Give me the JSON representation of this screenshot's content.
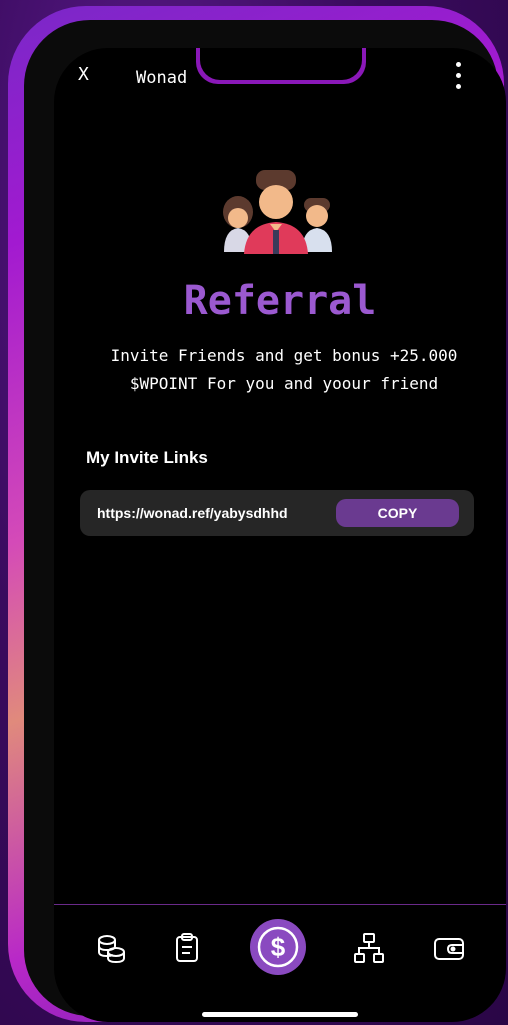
{
  "header": {
    "close_label": "X",
    "app_name": "Wonad"
  },
  "main": {
    "title": "Referral",
    "subtitle_line1": "Invite Friends and get bonus +25.000",
    "subtitle_line2": "$WPOINT For you and yoour friend",
    "invite_section_title": "My Invite Links",
    "invite_link": "https://wonad.ref/yabysdhhd",
    "copy_label": "COPY"
  },
  "nav": {
    "items": [
      "coins-icon",
      "clipboard-icon",
      "dollar-icon",
      "network-icon",
      "wallet-icon"
    ]
  },
  "colors": {
    "accent": "#9b59d0",
    "copy_button": "#6a3a90",
    "link_box": "#262626"
  }
}
